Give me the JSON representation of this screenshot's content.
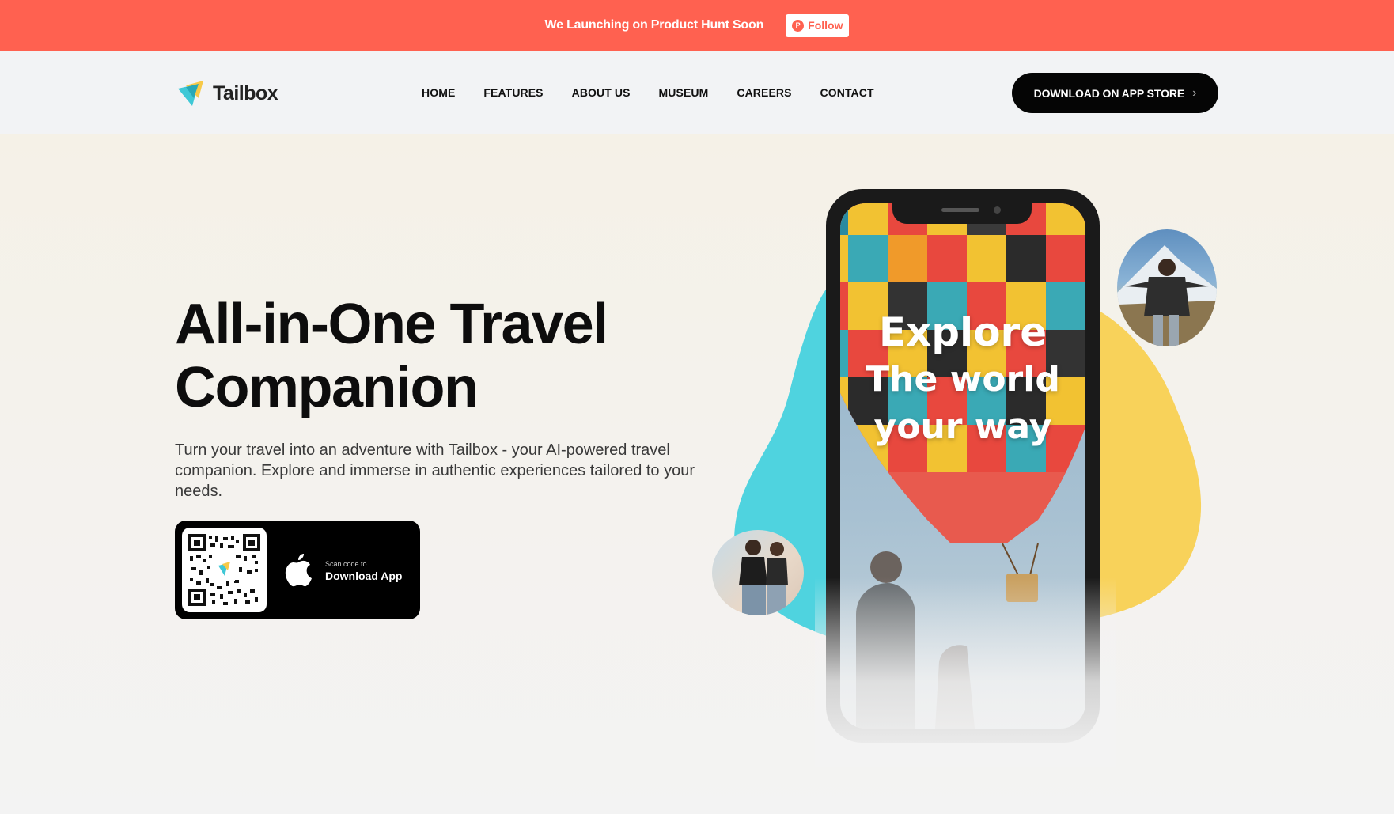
{
  "announcement": {
    "text": "We Launching on Product Hunt Soon",
    "follow_label": "Follow",
    "follow_icon": "product-hunt-icon",
    "bg_color": "#ff6150"
  },
  "header": {
    "logo_text": "Tailbox",
    "nav": [
      "HOME",
      "FEATURES",
      "ABOUT US",
      "MUSEUM",
      "CAREERS",
      "CONTACT"
    ],
    "cta_label": "DOWNLOAD ON APP STORE",
    "cta_icon": "chevron-right-icon"
  },
  "hero": {
    "title_line1": "All-in-One Travel",
    "title_line2": "Companion",
    "subtitle": "Turn your travel into an adventure with Tailbox - your AI-powered travel companion. Explore and immerse in authentic experiences tailored to your needs.",
    "qr_small": "Scan code to",
    "qr_big": "Download App",
    "store_icon": "apple-icon"
  },
  "phone_screen": {
    "line1": "Explore",
    "line2": "The world",
    "line3": "your way"
  },
  "colors": {
    "accent": "#ff6150",
    "teal": "#4fd3df",
    "yellow": "#f8d25a",
    "dark": "#050505"
  }
}
